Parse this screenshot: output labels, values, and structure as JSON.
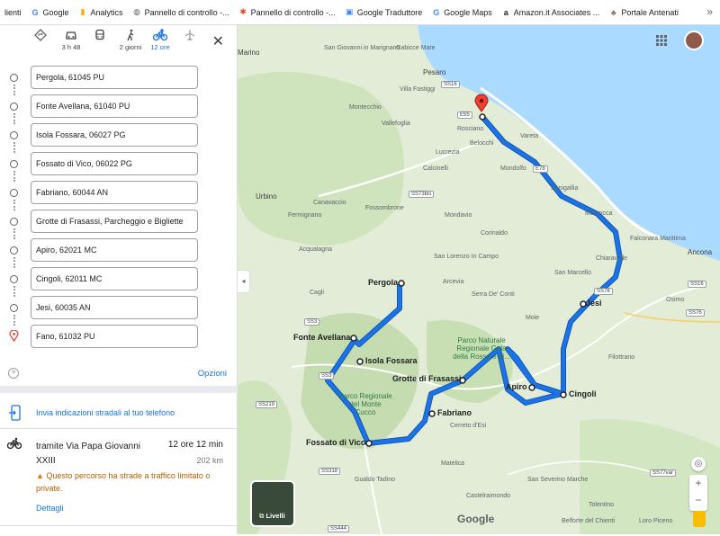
{
  "bookmarks": [
    {
      "label": "lienti",
      "icon": "none"
    },
    {
      "label": "Google",
      "icon": "google-icon"
    },
    {
      "label": "Analytics",
      "icon": "analytics-icon"
    },
    {
      "label": "Pannello di controllo -...",
      "icon": "globe-icon"
    },
    {
      "label": "Pannello di controllo -...",
      "icon": "joomla-icon"
    },
    {
      "label": "Google Traduttore",
      "icon": "translate-icon"
    },
    {
      "label": "Google Maps",
      "icon": "google-icon"
    },
    {
      "label": "Amazon.it Associates ...",
      "icon": "amazon-icon"
    },
    {
      "label": "Portale Antenati",
      "icon": "antenati-icon"
    }
  ],
  "modes": {
    "car_time": "3 h 48",
    "walk_time": "2 giorni",
    "bike_time": "12 ore"
  },
  "stops": [
    "Pergola, 61045 PU",
    "Fonte Avellana, 61040 PU",
    "Isola Fossara, 06027 PG",
    "Fossato di Vico, 06022 PG",
    "Fabriano, 60044 AN",
    "Grotte di Frasassi, Parcheggio e Bigliette",
    "Apiro, 62021 MC",
    "Cingoli, 62011 MC",
    "Jesi, 60035 AN",
    "Fano, 61032 PU"
  ],
  "options_label": "Opzioni",
  "send_label": "Invia indicazioni stradali al tuo telefono",
  "route": {
    "via": "tramite Via Papa Giovanni XXIII",
    "duration": "12 ore 12 min",
    "distance": "202 km",
    "warning": "Questo percorso ha strade a traffico limitato o private.",
    "details_label": "Dettagli"
  },
  "map": {
    "labels_big": [
      {
        "text": "Pergola"
      },
      {
        "text": "Fonte Avellana"
      },
      {
        "text": "Isola Fossara"
      },
      {
        "text": "Grotte di Frasassi"
      },
      {
        "text": "Fabriano"
      },
      {
        "text": "Fossato di Vico"
      },
      {
        "text": "Apiro"
      },
      {
        "text": "Cingoli"
      },
      {
        "text": "Jesi"
      }
    ],
    "labels_small": [
      "Marino",
      "San Giovanni in Marignano",
      "Gabicce Mare",
      "Pesaro",
      "Villa Fastiggi",
      "Montecchio",
      "Vallefoglia",
      "Rosciano",
      "Belocchi",
      "Lucrezia",
      "Calcinelli",
      "Mondolfo",
      "Urbino",
      "Fermignano",
      "Canavaccio",
      "Fossombrone",
      "Mondavio",
      "Senigallia",
      "Marzocca",
      "Falconara Marittima",
      "Ancona",
      "Chiaravalle",
      "Acqualagna",
      "Corinaldo",
      "San Lorenzo In Campo",
      "Cagli",
      "Arcevia",
      "San Marcello",
      "Moie",
      "Serra De' Conti",
      "Filottrano",
      "Cerreto d'Esi",
      "Matelica",
      "Gualdo Tadino",
      "San Severino Marche",
      "Castelraimondo",
      "Belforte del Chienti",
      "Loro Piceno",
      "Tolentino",
      "Osimo",
      "Vareta"
    ],
    "park1": "Parco Naturale Regionale Gola della Rossa e di...",
    "park2": "Parco Regionale del Monte Cucco",
    "shields": [
      "SS16",
      "SS73bis",
      "SS3",
      "SS76",
      "SS76",
      "SS16",
      "SS3",
      "SS219",
      "SS318",
      "SS444",
      "SS77var",
      "E55",
      "E78"
    ],
    "layers_label": "Livelli",
    "google_logo": "Google",
    "colors": {
      "route": "#1a73e8",
      "route_outline": "#1558b0",
      "sea": "#aadaff",
      "land": "#e2ecd6",
      "forest": "#c8dfb4"
    }
  }
}
